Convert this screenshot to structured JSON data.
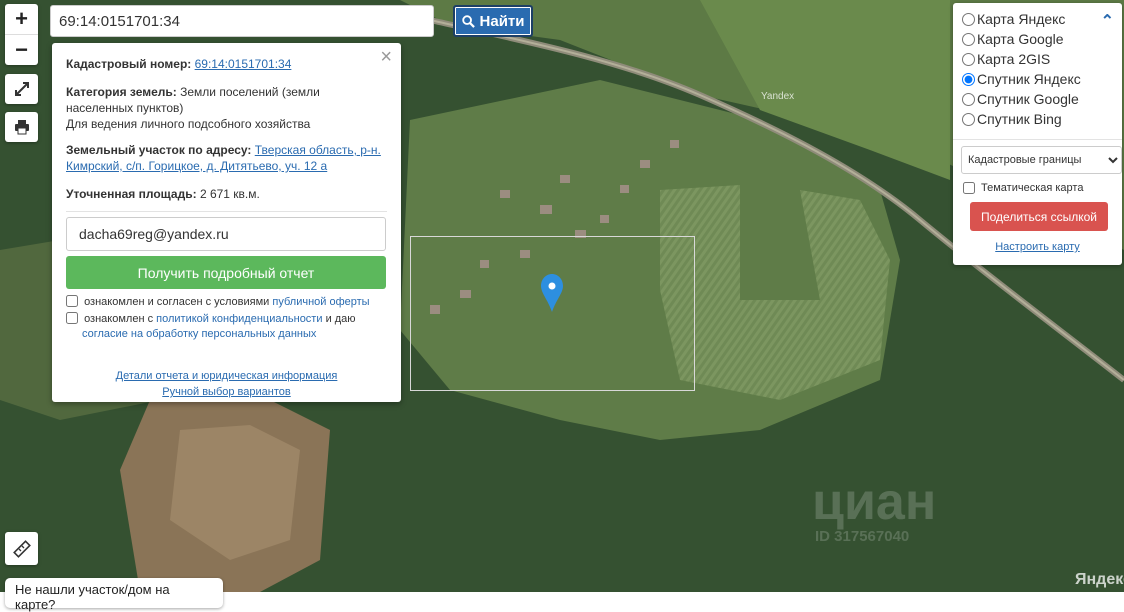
{
  "search": {
    "value": "69:14:0151701:34",
    "button_label": "Найти"
  },
  "zoom": {
    "in_label": "+",
    "out_label": "−"
  },
  "popup": {
    "close_label": "×",
    "cadastral_label": "Кадастровый номер:",
    "cadastral_value": "69:14:0151701:34",
    "category_label": "Категория земель:",
    "category_value": "Земли поселений (земли населенных пунктов)",
    "usage_value": "Для ведения личного подсобного хозяйства",
    "address_label": "Земельный участок по адресу:",
    "address_value": "Тверская область, р-н. Кимрский, с/п. Горицкое, д. Дитятьево, уч. 12 а",
    "area_label": "Уточненная площадь:",
    "area_value": "2 671 кв.м.",
    "email_value": "dacha69reg@yandex.ru",
    "report_button": "Получить подробный отчет",
    "check1_text": "ознакомлен и согласен с условиями",
    "check1_link": "публичной оферты",
    "check2_text": "ознакомлен с",
    "check2_link": "политикой конфиденциальности",
    "check2_text2": "и даю",
    "check2_link2": "согласие на обработку персональных данных",
    "details_link": "Детали отчета и юридическая информация",
    "manual_link": "Ручной выбор вариантов"
  },
  "layers": {
    "options": [
      {
        "label": "Карта Яндекс",
        "checked": false
      },
      {
        "label": "Карта Google",
        "checked": false
      },
      {
        "label": "Карта 2GIS",
        "checked": false
      },
      {
        "label": "Спутник Яндекс",
        "checked": true
      },
      {
        "label": "Спутник Google",
        "checked": false
      },
      {
        "label": "Спутник Bing",
        "checked": false
      }
    ],
    "select_value": "Кадастровые границы",
    "thematic_label": "Тематическая карта",
    "share_button": "Поделиться ссылкой",
    "configure_link": "Настроить карту"
  },
  "map": {
    "watermark_small": "Yandex",
    "watermark_large": "Яндекс",
    "cian_text": "циан",
    "cian_id": "ID 317567040"
  },
  "bottom_tip": "Не нашли участок/дом на карте?",
  "colors": {
    "accent": "#2a6bb0",
    "report_button": "#5cb85c",
    "share_button": "#d9534f",
    "marker": "#2d8fe0"
  }
}
